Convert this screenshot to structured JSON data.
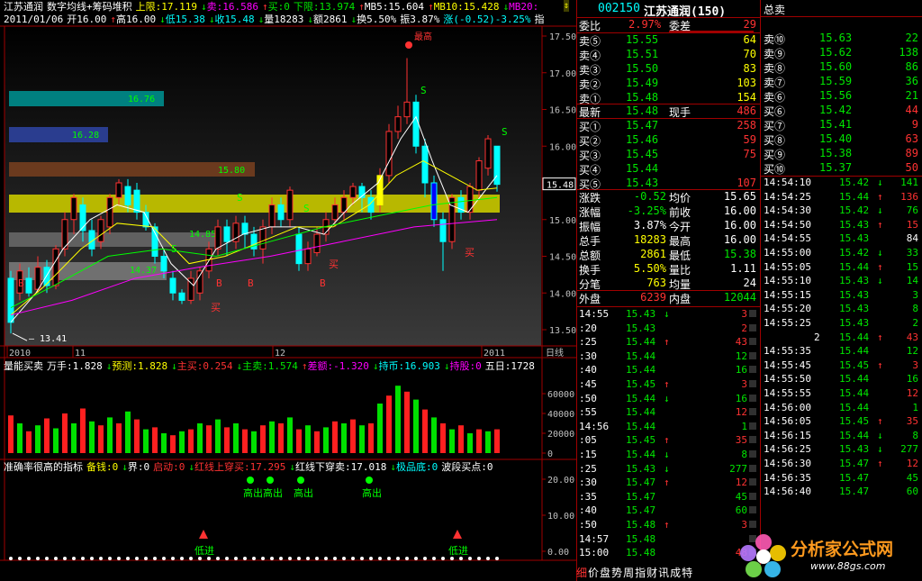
{
  "top_bar": {
    "line1": [
      {
        "t": "江苏通润",
        "c": "#ffffff"
      },
      {
        "t": "数字均线+筹码堆积",
        "c": "#ffffff"
      },
      {
        "t": "上限:17.119",
        "c": "#ffff00"
      },
      {
        "t": "↓",
        "c": "#00e600"
      },
      {
        "t": "卖:16.586",
        "c": "#ff00ff"
      },
      {
        "t": "↑",
        "c": "#ff3232"
      },
      {
        "t": "买:0",
        "c": "#00e600"
      },
      {
        "t": "下限:13.974",
        "c": "#00e600"
      },
      {
        "t": "↑",
        "c": "#ff3232"
      },
      {
        "t": "MB5:15.604",
        "c": "#ffffff"
      },
      {
        "t": "↑",
        "c": "#ff3232"
      },
      {
        "t": "MB10:15.428",
        "c": "#ffff00"
      },
      {
        "t": "↓",
        "c": "#00e600"
      },
      {
        "t": "MB20:",
        "c": "#ff00ff"
      }
    ],
    "line2": [
      {
        "t": "2011/01/06",
        "c": "#ffffff"
      },
      {
        "t": "开16.00",
        "c": "#ffffff"
      },
      {
        "t": "↑",
        "c": "#ff3232"
      },
      {
        "t": "高16.00",
        "c": "#ffffff"
      },
      {
        "t": "↓",
        "c": "#00e600"
      },
      {
        "t": "低15.38",
        "c": "#00ffff"
      },
      {
        "t": "↓",
        "c": "#00e600"
      },
      {
        "t": "收15.48",
        "c": "#00ffff"
      },
      {
        "t": "↓",
        "c": "#00e600"
      },
      {
        "t": "量18283",
        "c": "#ffffff"
      },
      {
        "t": "↓",
        "c": "#00e600"
      },
      {
        "t": "额2861",
        "c": "#ffffff"
      },
      {
        "t": "↓",
        "c": "#00e600"
      },
      {
        "t": "换5.50%",
        "c": "#ffffff"
      },
      {
        "t": "振3.87%",
        "c": "#ffffff"
      },
      {
        "t": "涨(-0.52)-3.25%",
        "c": "#00ffff"
      },
      {
        "t": "指",
        "c": "#ffffff"
      }
    ]
  },
  "price_axis": [
    "17.50",
    "17.00",
    "16.50",
    "16.00",
    "15.50",
    "15.00",
    "14.50",
    "14.00",
    "13.50"
  ],
  "price_tag": "15.48",
  "low_label": "13.41",
  "high_label": "最高",
  "x_axis": [
    "2010",
    "11",
    "12",
    "2011"
  ],
  "x_axis_right": "日线",
  "chip_bands": [
    {
      "label": "16.76",
      "color": "#008080"
    },
    {
      "label": "16.28",
      "color": "#2a3d8f"
    },
    {
      "label": "15.80",
      "color": "#6b3a1e"
    },
    {
      "label": "",
      "color": "#b8b800"
    },
    {
      "label": "",
      "color": "#606060"
    },
    {
      "label": "14.37",
      "color": "#707070"
    }
  ],
  "band_side_labels": [
    "14.85"
  ],
  "signal_labels": {
    "buy": "买",
    "b": "B",
    "s": "S"
  },
  "vol_panel": {
    "header": [
      {
        "t": "量能买卖",
        "c": "#ffffff"
      },
      {
        "t": "万手:1.828",
        "c": "#ffffff"
      },
      {
        "t": "↓",
        "c": "#00e600"
      },
      {
        "t": "预测:1.828",
        "c": "#ffff00"
      },
      {
        "t": "↓",
        "c": "#00e600"
      },
      {
        "t": "主买:0.254",
        "c": "#ff3232"
      },
      {
        "t": "↓",
        "c": "#00e600"
      },
      {
        "t": "主卖:1.574",
        "c": "#00e600"
      },
      {
        "t": "↑",
        "c": "#ff3232"
      },
      {
        "t": "差额:-1.320",
        "c": "#ff00ff"
      },
      {
        "t": "↓",
        "c": "#00e600"
      },
      {
        "t": "持币:16.903",
        "c": "#00ffff"
      },
      {
        "t": "↓",
        "c": "#00e600"
      },
      {
        "t": "持股:0",
        "c": "#ff00ff"
      },
      {
        "t": "五日:1728",
        "c": "#ffffff"
      }
    ],
    "axis": [
      "60000",
      "40000",
      "20000",
      "0"
    ]
  },
  "ind_panel": {
    "header": [
      {
        "t": "准确率很高的指标",
        "c": "#ffffff"
      },
      {
        "t": "备钱:0",
        "c": "#ffff00"
      },
      {
        "t": "↓",
        "c": "#00e600"
      },
      {
        "t": "界:0",
        "c": "#ffffff"
      },
      {
        "t": "启动:0",
        "c": "#ff3232"
      },
      {
        "t": "↓",
        "c": "#00e600"
      },
      {
        "t": "红线上穿买:17.295",
        "c": "#ff3232"
      },
      {
        "t": "↓",
        "c": "#00e600"
      },
      {
        "t": "红线下穿卖:17.018",
        "c": "#ffffff"
      },
      {
        "t": "↓",
        "c": "#00e600"
      },
      {
        "t": "极品底:0",
        "c": "#00ffff"
      },
      {
        "t": "波段买点:0",
        "c": "#ffffff"
      }
    ],
    "axis": [
      "20.00",
      "10.00",
      "0.00"
    ],
    "labels": {
      "gaochu": "高出",
      "dijin": "低进"
    }
  },
  "quote": {
    "code": "002150",
    "name": "江苏通润(150)",
    "weibi_label": "委比",
    "weibi": "2.97%",
    "weicha_label": "委差",
    "weicha": "29",
    "asks": [
      {
        "label": "卖⑤",
        "price": "15.55",
        "vol": "64"
      },
      {
        "label": "卖④",
        "price": "15.51",
        "vol": "70"
      },
      {
        "label": "卖③",
        "price": "15.50",
        "vol": "83"
      },
      {
        "label": "卖②",
        "price": "15.49",
        "vol": "103"
      },
      {
        "label": "卖①",
        "price": "15.48",
        "vol": "154"
      }
    ],
    "last": {
      "label": "最新",
      "price": "15.48",
      "xs_label": "现手",
      "xs": "486"
    },
    "bids": [
      {
        "label": "买①",
        "price": "15.47",
        "vol": "258"
      },
      {
        "label": "买②",
        "price": "15.46",
        "vol": "59"
      },
      {
        "label": "买③",
        "price": "15.45",
        "vol": "75"
      },
      {
        "label": "买④",
        "price": "15.44",
        "vol": ""
      },
      {
        "label": "买⑤",
        "price": "15.43",
        "vol": "107"
      }
    ],
    "stats": [
      {
        "l": "涨跌",
        "v": "-0.52",
        "vc": "#00e600",
        "l2": "均价",
        "v2": "15.65",
        "v2c": "#ffffff"
      },
      {
        "l": "涨幅",
        "v": "-3.25%",
        "vc": "#00e600",
        "l2": "前收",
        "v2": "16.00",
        "v2c": "#ffffff"
      },
      {
        "l": "振幅",
        "v": "3.87%",
        "vc": "#ffffff",
        "l2": "今开",
        "v2": "16.00",
        "v2c": "#ffffff"
      },
      {
        "l": "总手",
        "v": "18283",
        "vc": "#ffff00",
        "l2": "最高",
        "v2": "16.00",
        "v2c": "#ffffff"
      },
      {
        "l": "总额",
        "v": "2861",
        "vc": "#ffff00",
        "l2": "最低",
        "v2": "15.38",
        "v2c": "#00e600"
      },
      {
        "l": "换手",
        "v": "5.50%",
        "vc": "#ffff00",
        "l2": "量比",
        "v2": "1.11",
        "v2c": "#ffffff"
      },
      {
        "l": "分笔",
        "v": "763",
        "vc": "#ffff00",
        "l2": "均量",
        "v2": "24",
        "v2c": "#ffffff"
      }
    ],
    "waipan_label": "外盘",
    "waipan": "6239",
    "neipan_label": "内盘",
    "neipan": "12044"
  },
  "ticks_left": [
    {
      "t": "14:55",
      "p": "15.43",
      "v": "3",
      "d": "↓",
      "dc": "#00e600",
      "vc": "#ff3232"
    },
    {
      "t": ":20",
      "p": "15.43",
      "v": "2",
      "d": "",
      "dc": "",
      "vc": "#ff3232"
    },
    {
      "t": ":25",
      "p": "15.44",
      "v": "43",
      "d": "↑",
      "dc": "#ff3232",
      "vc": "#ff3232"
    },
    {
      "t": ":30",
      "p": "15.44",
      "v": "12",
      "d": "",
      "dc": "",
      "vc": "#00e600"
    },
    {
      "t": ":40",
      "p": "15.44",
      "v": "16",
      "d": "",
      "dc": "",
      "vc": "#00e600"
    },
    {
      "t": ":45",
      "p": "15.45",
      "v": "3",
      "d": "↑",
      "dc": "#ff3232",
      "vc": "#ff3232"
    },
    {
      "t": ":50",
      "p": "15.44",
      "v": "16",
      "d": "↓",
      "dc": "#00e600",
      "vc": "#00e600"
    },
    {
      "t": ":55",
      "p": "15.44",
      "v": "12",
      "d": "",
      "dc": "",
      "vc": "#ff3232"
    },
    {
      "t": "14:56",
      "p": "15.44",
      "v": "1",
      "d": "",
      "dc": "",
      "vc": "#00e600"
    },
    {
      "t": ":05",
      "p": "15.45",
      "v": "35",
      "d": "↑",
      "dc": "#ff3232",
      "vc": "#ff3232"
    },
    {
      "t": ":15",
      "p": "15.44",
      "v": "8",
      "d": "↓",
      "dc": "#00e600",
      "vc": "#00e600"
    },
    {
      "t": ":25",
      "p": "15.43",
      "v": "277",
      "d": "↓",
      "dc": "#00e600",
      "vc": "#00e600"
    },
    {
      "t": ":30",
      "p": "15.47",
      "v": "12",
      "d": "↑",
      "dc": "#ff3232",
      "vc": "#ff3232"
    },
    {
      "t": ":35",
      "p": "15.47",
      "v": "45",
      "d": "",
      "dc": "",
      "vc": "#00e600"
    },
    {
      "t": ":40",
      "p": "15.47",
      "v": "60",
      "d": "",
      "dc": "",
      "vc": "#00e600"
    },
    {
      "t": ":50",
      "p": "15.48",
      "v": "3",
      "d": "↑",
      "dc": "#ff3232",
      "vc": "#ff3232"
    },
    {
      "t": "14:57",
      "p": "15.48",
      "v": "",
      "d": "",
      "dc": "",
      "vc": "#00e600"
    },
    {
      "t": "15:00",
      "p": "15.48",
      "v": "48",
      "d": "",
      "dc": "",
      "vc": "#ff3232"
    }
  ],
  "right_panel": {
    "title_sell": "总卖",
    "title_buy": "总买",
    "asks10": [
      {
        "label": "卖⑩",
        "price": "15.63",
        "vol": "22"
      },
      {
        "label": "卖⑨",
        "price": "15.62",
        "vol": "138"
      },
      {
        "label": "卖⑧",
        "price": "15.60",
        "vol": "86"
      },
      {
        "label": "卖⑦",
        "price": "15.59",
        "vol": "36"
      },
      {
        "label": "卖⑥",
        "price": "15.56",
        "vol": "21"
      }
    ],
    "bids10": [
      {
        "label": "买⑥",
        "price": "15.42",
        "vol": "44"
      },
      {
        "label": "买⑦",
        "price": "15.41",
        "vol": "9"
      },
      {
        "label": "买⑧",
        "price": "15.40",
        "vol": "63"
      },
      {
        "label": "买⑨",
        "price": "15.38",
        "vol": "89"
      },
      {
        "label": "买⑩",
        "price": "15.37",
        "vol": "50"
      }
    ]
  },
  "ticks_right": [
    {
      "t": "14:54:10",
      "p": "15.42",
      "v": "141",
      "d": "↓",
      "dc": "#00e600",
      "vc": "#00e600"
    },
    {
      "t": "14:54:25",
      "p": "15.44",
      "v": "136",
      "d": "↑",
      "dc": "#ff3232",
      "vc": "#ff3232"
    },
    {
      "t": "14:54:30",
      "p": "15.42",
      "v": "76",
      "d": "↓",
      "dc": "#00e600",
      "vc": "#00e600"
    },
    {
      "t": "14:54:50",
      "p": "15.43",
      "v": "15",
      "d": "↑",
      "dc": "#ff3232",
      "vc": "#ff3232"
    },
    {
      "t": "14:54:55",
      "p": "15.43",
      "v": "84",
      "d": "",
      "dc": "",
      "vc": "#ffffff"
    },
    {
      "t": "14:55:00",
      "p": "15.42",
      "v": "33",
      "d": "↓",
      "dc": "#00e600",
      "vc": "#00e600"
    },
    {
      "t": "14:55:05",
      "p": "15.44",
      "v": "15",
      "d": "↑",
      "dc": "#ff3232",
      "vc": "#00e600"
    },
    {
      "t": "14:55:10",
      "p": "15.43",
      "v": "14",
      "d": "↓",
      "dc": "#00e600",
      "vc": "#00e600"
    },
    {
      "t": "14:55:15",
      "p": "15.43",
      "v": "3",
      "d": "",
      "dc": "",
      "vc": "#00e600"
    },
    {
      "t": "14:55:20",
      "p": "15.43",
      "v": "8",
      "d": "",
      "dc": "",
      "vc": "#00e600"
    },
    {
      "t": "14:55:25",
      "p": "15.43",
      "v": "2",
      "d": "",
      "dc": "",
      "vc": "#00e600"
    },
    {
      "t": "",
      "p": "15.44",
      "v": "43",
      "d": "↑",
      "dc": "#ff3232",
      "vc": "#ff3232",
      "pre": "2"
    },
    {
      "t": "14:55:35",
      "p": "15.44",
      "v": "12",
      "d": "",
      "dc": "",
      "vc": "#00e600"
    },
    {
      "t": "14:55:45",
      "p": "15.45",
      "v": "3",
      "d": "↑",
      "dc": "#ff3232",
      "vc": "#ff3232"
    },
    {
      "t": "14:55:50",
      "p": "15.44",
      "v": "16",
      "d": "",
      "dc": "",
      "vc": "#00e600"
    },
    {
      "t": "14:55:55",
      "p": "15.44",
      "v": "12",
      "d": "",
      "dc": "",
      "vc": "#ff3232"
    },
    {
      "t": "14:56:00",
      "p": "15.44",
      "v": "1",
      "d": "",
      "dc": "",
      "vc": "#00e600"
    },
    {
      "t": "14:56:05",
      "p": "15.45",
      "v": "35",
      "d": "↑",
      "dc": "#ff3232",
      "vc": "#ff3232"
    },
    {
      "t": "14:56:15",
      "p": "15.44",
      "v": "8",
      "d": "↓",
      "dc": "#00e600",
      "vc": "#00e600"
    },
    {
      "t": "14:56:25",
      "p": "15.43",
      "v": "277",
      "d": "↓",
      "dc": "#00e600",
      "vc": "#00e600"
    },
    {
      "t": "14:56:30",
      "p": "15.47",
      "v": "12",
      "d": "↑",
      "dc": "#ff3232",
      "vc": "#ff3232"
    },
    {
      "t": "14:56:35",
      "p": "15.47",
      "v": "45",
      "d": "",
      "dc": "",
      "vc": "#00e600"
    },
    {
      "t": "14:56:40",
      "p": "15.47",
      "v": "60",
      "d": "",
      "dc": "",
      "vc": "#00e600"
    }
  ],
  "bottom_tabs": [
    {
      "t": "细",
      "c": "#ff3232"
    },
    {
      "t": "价",
      "c": "#ffffff"
    },
    {
      "t": "盘",
      "c": "#ffffff"
    },
    {
      "t": "势",
      "c": "#ffffff"
    },
    {
      "t": "周",
      "c": "#ffffff"
    },
    {
      "t": "指",
      "c": "#ffffff"
    },
    {
      "t": "财",
      "c": "#ffffff"
    },
    {
      "t": "讯",
      "c": "#ffffff"
    },
    {
      "t": "成",
      "c": "#ffffff"
    },
    {
      "t": "特",
      "c": "#ffffff"
    }
  ],
  "watermark": {
    "text": "分析家公式网",
    "url": "www.88gs.com"
  },
  "colors": {
    "up": "#ff3232",
    "down": "#00ffff",
    "border": "#a00000",
    "bg": "#000000"
  }
}
